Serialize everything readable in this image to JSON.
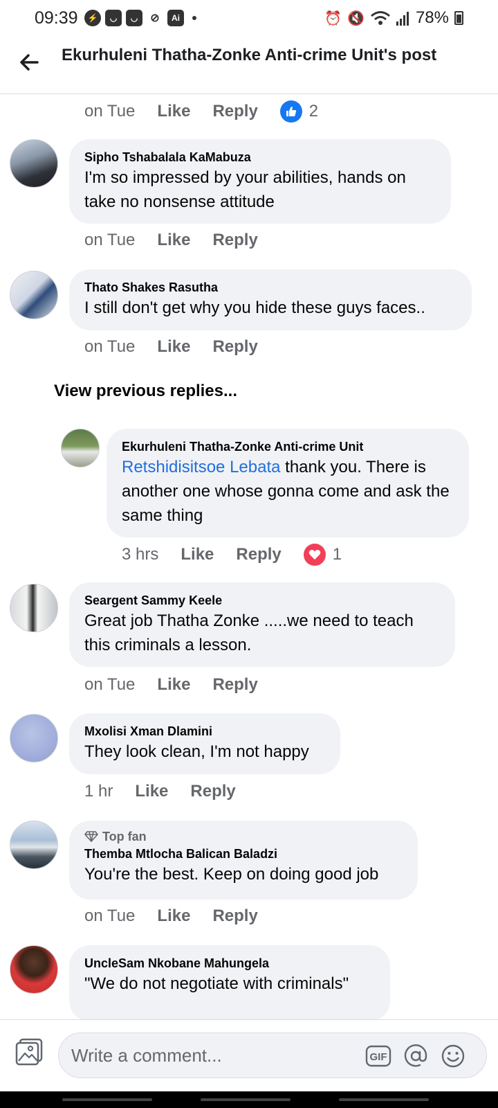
{
  "status_bar": {
    "time": "09:39",
    "battery": "78%"
  },
  "header": {
    "title": "Ekurhuleni Thatha-Zonke Anti-crime Unit's post"
  },
  "actions": {
    "like": "Like",
    "reply": "Reply"
  },
  "top_partial": {
    "time": "on Tue",
    "reaction_count": "2"
  },
  "comments": [
    {
      "author": "Sipho Tshabalala KaMabuza",
      "text": "I'm so impressed by your abilities, hands on take no nonsense attitude",
      "time": "on Tue"
    },
    {
      "author": "Thato Shakes Rasutha",
      "text": "I still don't get why you hide these guys faces..",
      "time": "on Tue"
    },
    {
      "author": "Seargent Sammy Keele",
      "text": "Great job Thatha Zonke .....we need to teach this criminals a lesson.",
      "time": "on Tue"
    },
    {
      "author": "Mxolisi Xman Dlamini",
      "text": "They look clean, I'm not happy",
      "time": "1 hr"
    },
    {
      "badge": "Top fan",
      "author": "Themba Mtlocha Balican Baladzi",
      "text": "You're the best. Keep on doing good job",
      "time": "on Tue"
    },
    {
      "author": "UncleSam Nkobane Mahungela",
      "text": "\"We do not negotiate with criminals\""
    }
  ],
  "view_previous": "View previous replies...",
  "reply": {
    "author": "Ekurhuleni Thatha-Zonke Anti-crime Unit",
    "mention": "Retshidisitsoe Lebata",
    "text": " thank you. There is another one whose gonna come and ask the same thing",
    "time": "3 hrs",
    "reaction_count": "1"
  },
  "composer": {
    "placeholder": "Write a comment...",
    "gif_label": "GIF"
  },
  "colors": {
    "bubble": "#f0f2f5",
    "link": "#216fdb",
    "like": "#1877f2",
    "love": "#f33e58"
  }
}
